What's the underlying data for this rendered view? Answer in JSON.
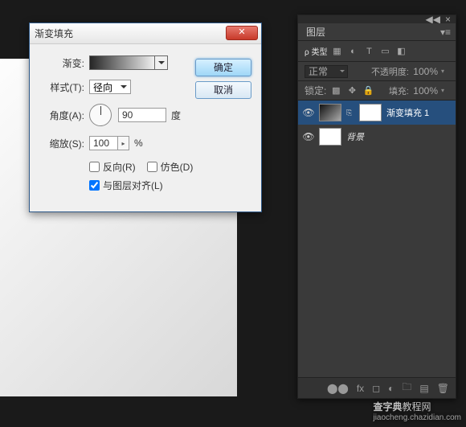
{
  "dialog": {
    "title": "渐变填充",
    "gradient_label": "渐变:",
    "style_label": "样式(T):",
    "style_value": "径向",
    "angle_label": "角度(A):",
    "angle_value": "90",
    "angle_unit": "度",
    "scale_label": "缩放(S):",
    "scale_value": "100",
    "scale_unit": "%",
    "reverse_label": "反向(R)",
    "dither_label": "仿色(D)",
    "align_label": "与图层对齐(L)",
    "ok": "确定",
    "cancel": "取消"
  },
  "panel": {
    "tab": "图层",
    "kind_label": "ρ 类型",
    "blend_mode": "正常",
    "opacity_label": "不透明度:",
    "opacity_value": "100%",
    "lock_label": "锁定:",
    "fill_label": "填充:",
    "fill_value": "100%",
    "layers": [
      {
        "name": "渐变填充 1"
      },
      {
        "name": "背景"
      }
    ]
  },
  "watermark": {
    "brand": "查字典",
    "suffix": "教程网",
    "url": "jiaocheng.chazidian.com"
  }
}
